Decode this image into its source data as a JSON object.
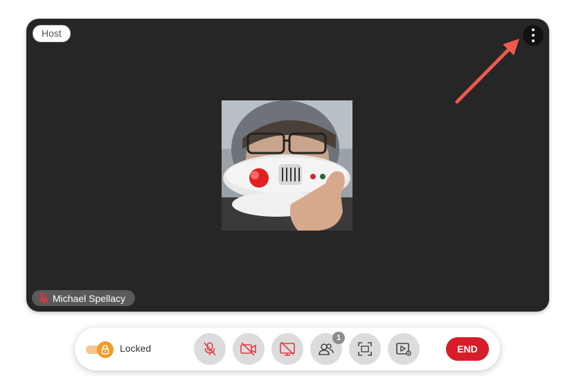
{
  "video": {
    "host_badge": "Host",
    "participant_name": "Michael Spellacy"
  },
  "toolbar": {
    "lock_label": "Locked",
    "participants_count": "1",
    "end_label": "END",
    "buttons": [
      "mic-muted",
      "camera-off",
      "screen-share-off",
      "participants",
      "fullscreen",
      "media-settings"
    ]
  },
  "colors": {
    "tile_bg": "#262626",
    "accent_orange": "#f29b26",
    "end_red": "#d61e2a",
    "muted_red": "#e0393e",
    "arrow": "#ec5a4d"
  }
}
